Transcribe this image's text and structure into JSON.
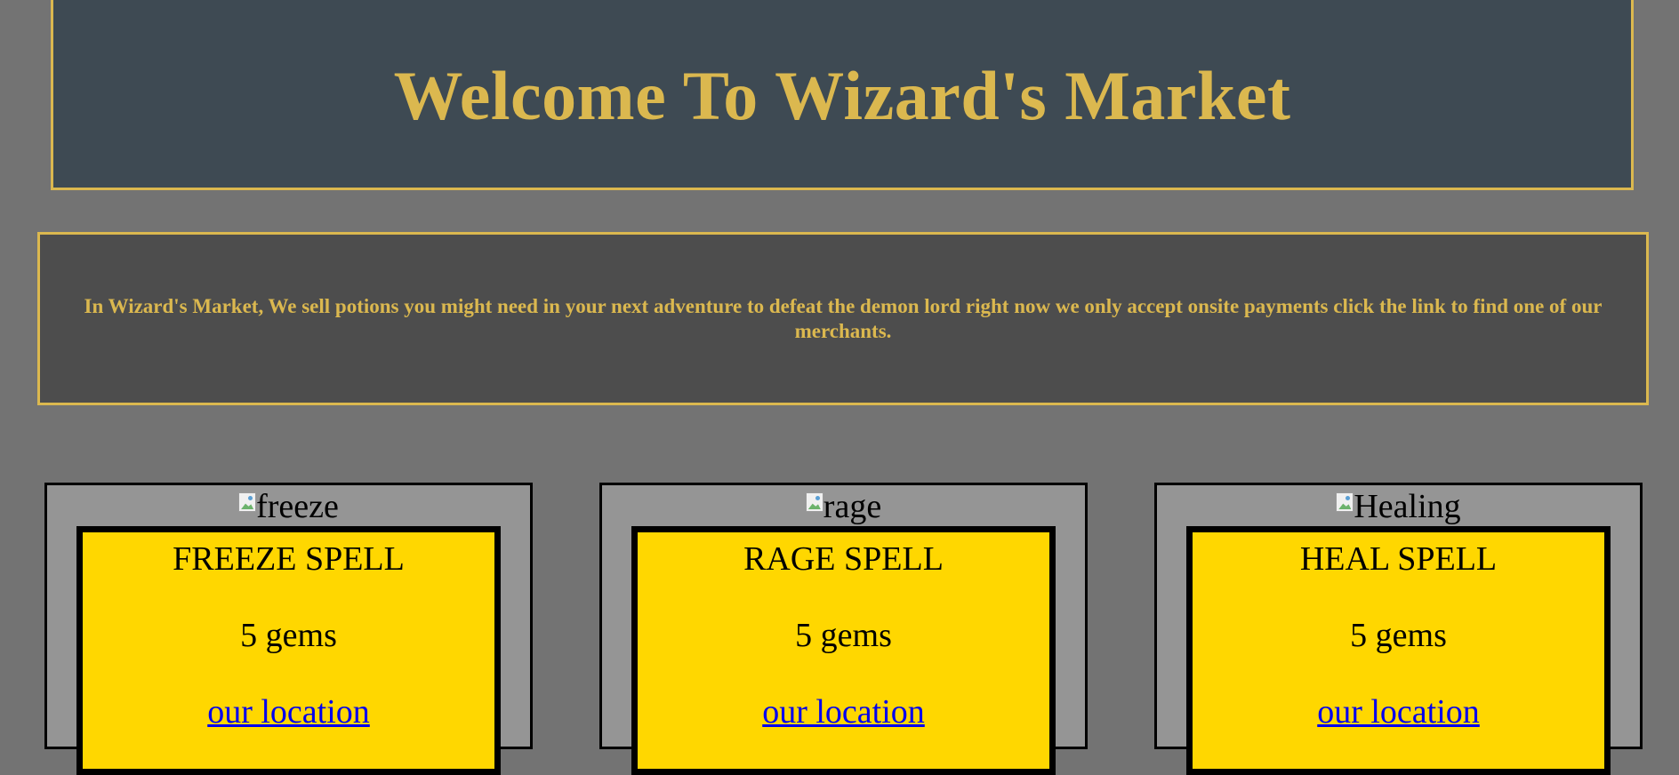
{
  "header": {
    "title": "Welcome To Wizard's Market"
  },
  "intro": {
    "text": "In Wizard's Market, We sell potions you might need in your next adventure to defeat the demon lord right now we only accept onsite payments click the link to find one of our merchants."
  },
  "cards": [
    {
      "image_alt": "freeze",
      "title": "FREEZE SPELL",
      "price": "5 gems",
      "link_label": "our location"
    },
    {
      "image_alt": "rage",
      "title": "RAGE SPELL",
      "price": "5 gems",
      "link_label": "our location"
    },
    {
      "image_alt": "Healing",
      "title": "HEAL SPELL",
      "price": "5 gems",
      "link_label": "our location"
    }
  ],
  "icons": {
    "broken_image": "broken-image-icon"
  },
  "colors": {
    "page_background": "#737373",
    "header_background": "#3e4a53",
    "intro_background": "#4d4d4d",
    "accent_gold": "#dbb84f",
    "card_background": "#959595",
    "card_inner": "#ffd700",
    "link": "#0000ee"
  }
}
